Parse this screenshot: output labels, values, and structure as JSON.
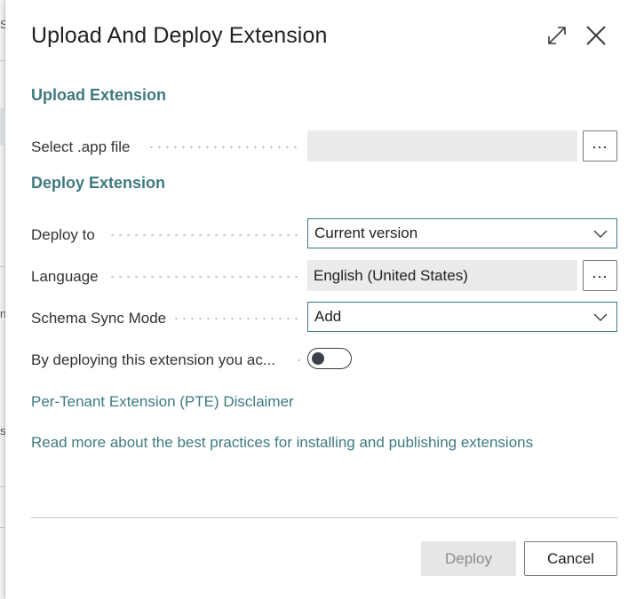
{
  "background": {
    "chars": [
      "S",
      "n",
      "s"
    ]
  },
  "dialog": {
    "title": "Upload And Deploy Extension",
    "expand_icon": "expand-icon",
    "close_icon": "close-icon"
  },
  "upload_section": {
    "title": "Upload Extension",
    "select_file": {
      "label": "Select .app file",
      "value": "",
      "lookup_label": "..."
    }
  },
  "deploy_section": {
    "title": "Deploy Extension",
    "deploy_to": {
      "label": "Deploy to",
      "value": "Current version"
    },
    "language": {
      "label": "Language",
      "value": "English (United States)",
      "lookup_label": "..."
    },
    "schema_sync_mode": {
      "label": "Schema Sync Mode",
      "value": "Add"
    },
    "accept": {
      "label": "By deploying this extension you ac...",
      "checked": false
    }
  },
  "links": {
    "disclaimer": "Per-Tenant Extension (PTE) Disclaimer",
    "best_practices": "Read more about the best practices for installing and publishing extensions"
  },
  "footer": {
    "deploy_label": "Deploy",
    "cancel_label": "Cancel"
  },
  "colors": {
    "accent": "#3f7a80",
    "readonly_bg": "#ebebeb",
    "disabled_text": "#8a8a8a"
  }
}
